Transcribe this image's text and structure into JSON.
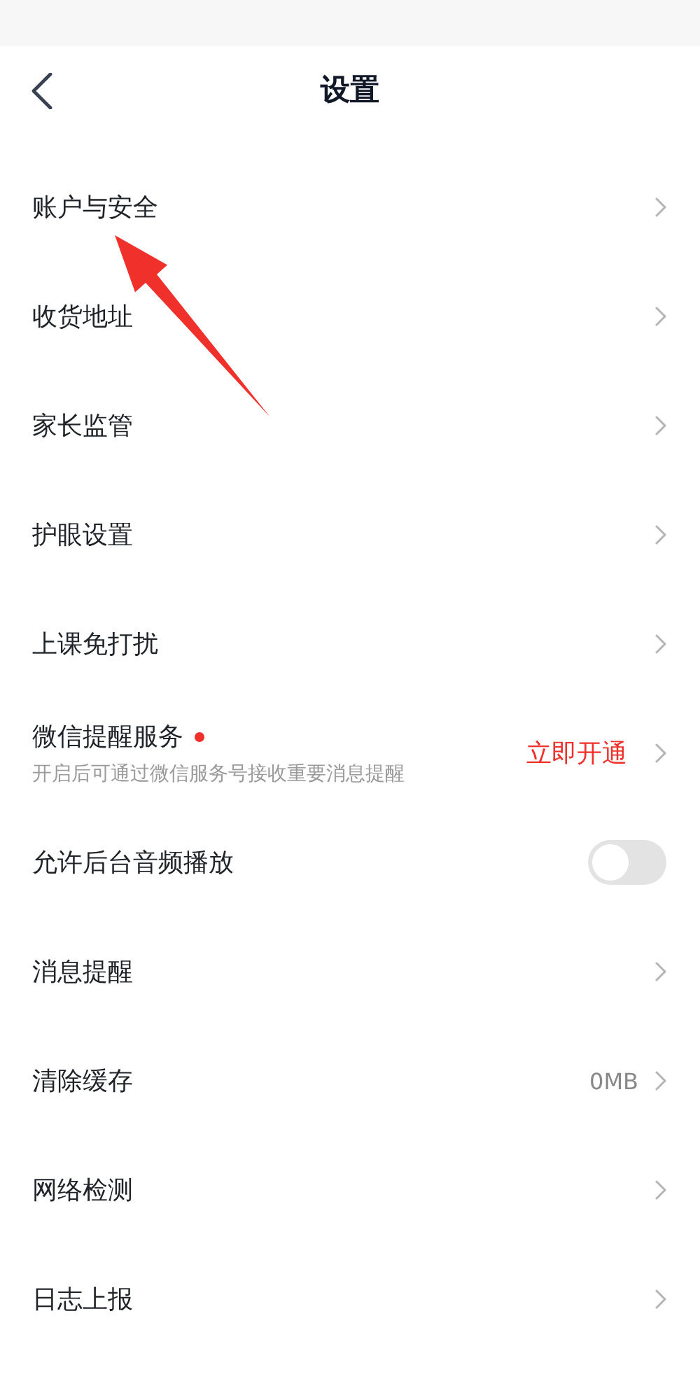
{
  "header": {
    "title": "设置"
  },
  "items": [
    {
      "kind": "link",
      "label": "账户与安全"
    },
    {
      "kind": "link",
      "label": "收货地址"
    },
    {
      "kind": "link",
      "label": "家长监管"
    },
    {
      "kind": "link",
      "label": "护眼设置"
    },
    {
      "kind": "link",
      "label": "上课免打扰"
    },
    {
      "kind": "service",
      "label": "微信提醒服务",
      "unread": true,
      "color": "#f0302a",
      "subtitle": "开启后可通过微信服务号接收重要消息提醒",
      "action": "立即开通"
    },
    {
      "kind": "toggle",
      "label": "允许后台音频播放",
      "on": false
    },
    {
      "kind": "link",
      "label": "消息提醒"
    },
    {
      "kind": "link",
      "label": "清除缓存",
      "value": "0MB"
    },
    {
      "kind": "link",
      "label": "网络检测"
    },
    {
      "kind": "link",
      "label": "日志上报"
    }
  ]
}
